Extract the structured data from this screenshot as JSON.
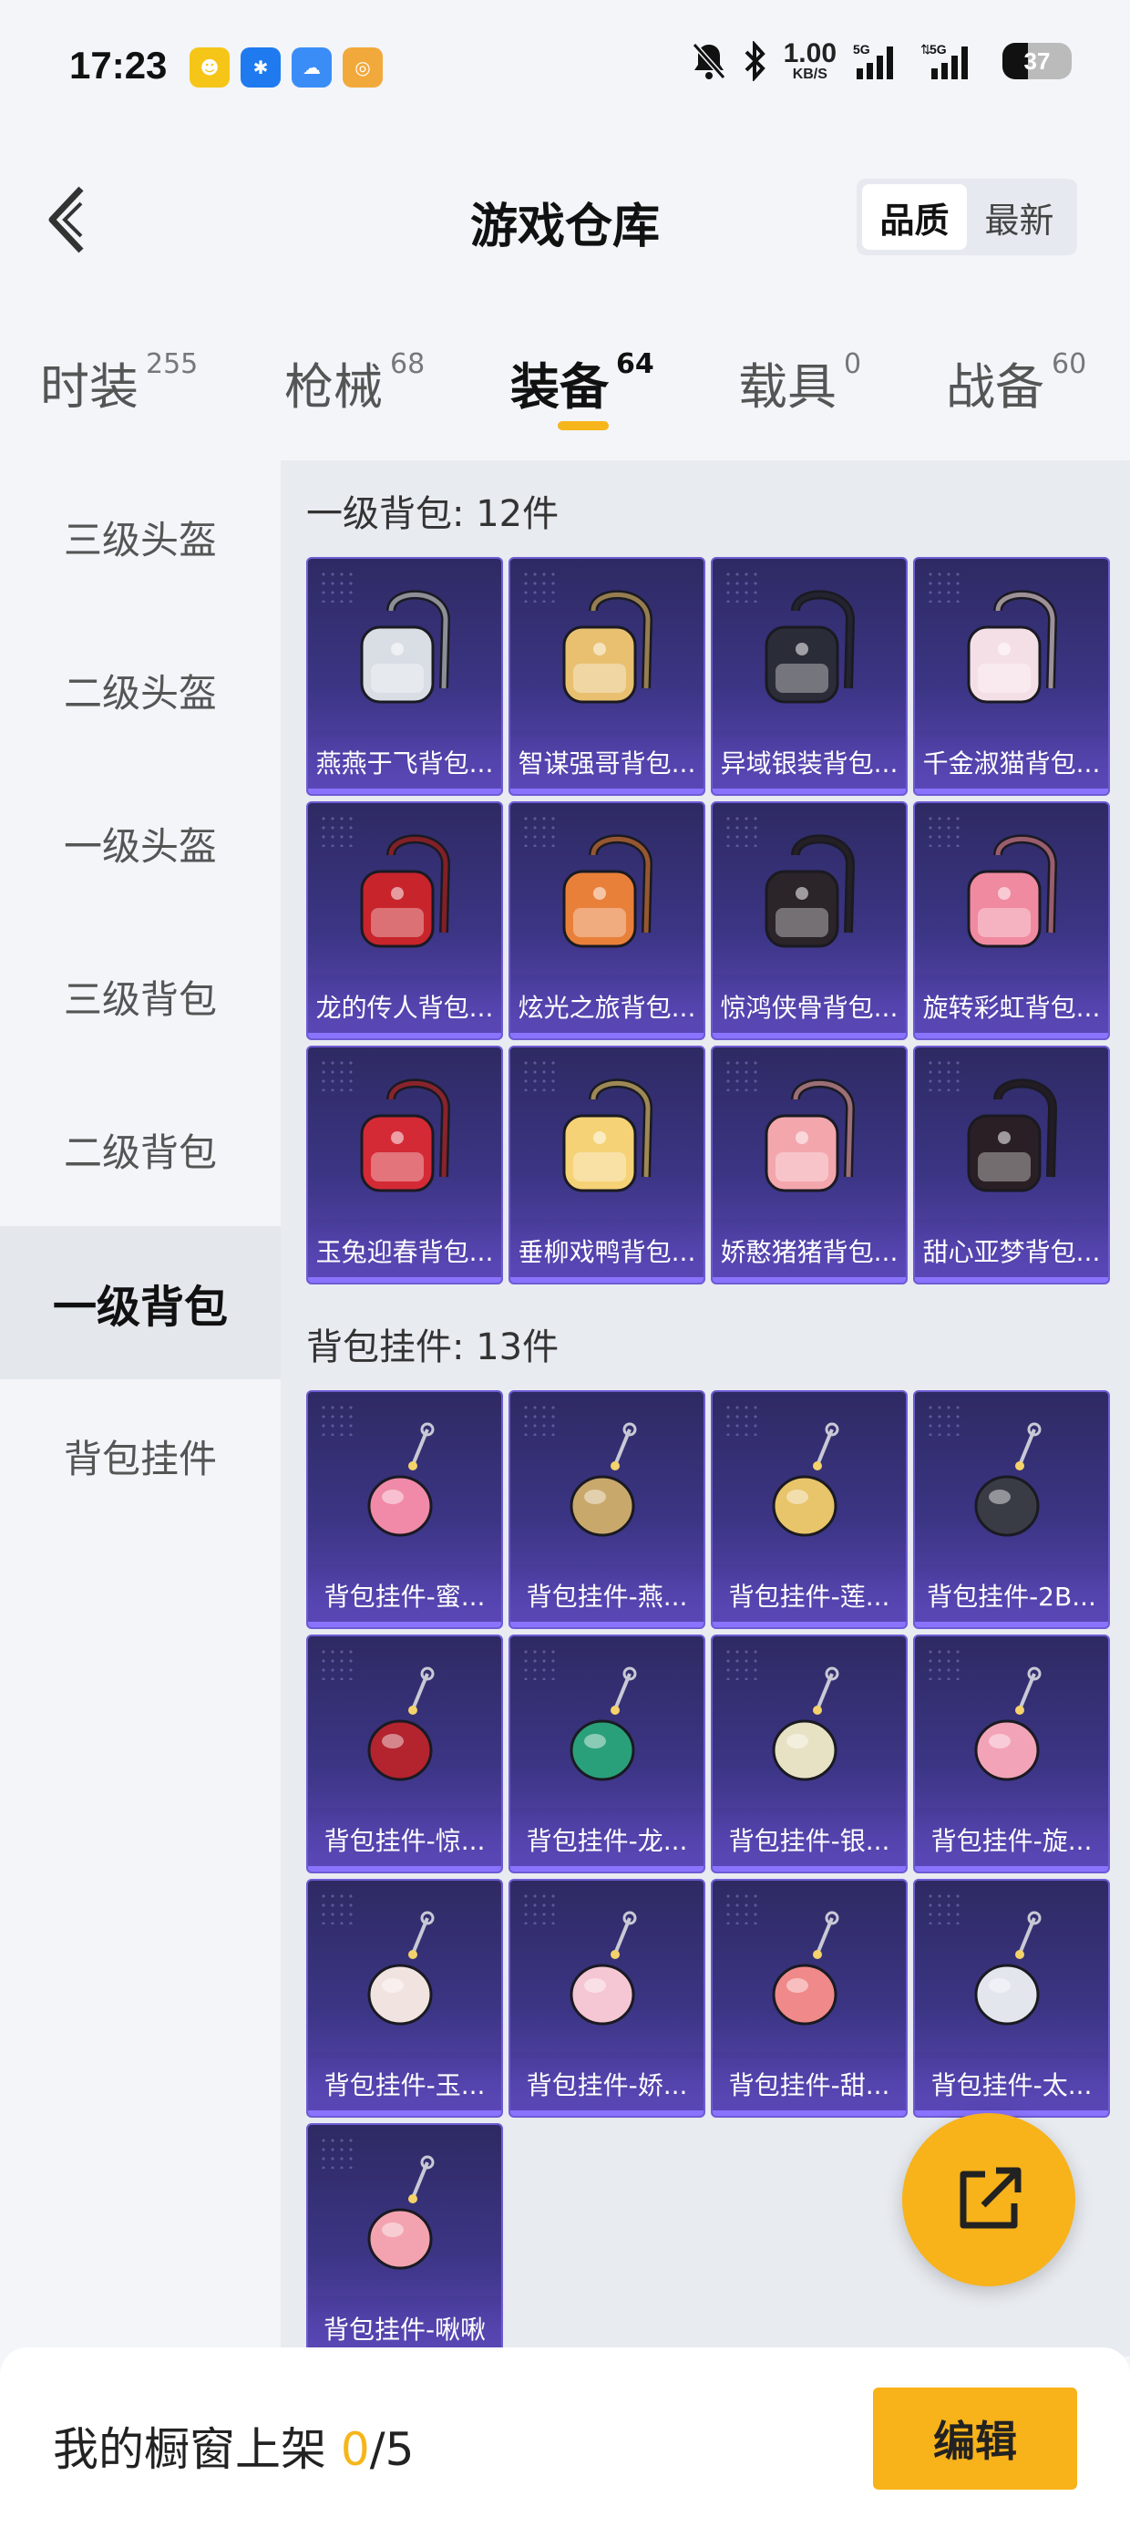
{
  "status_bar": {
    "time": "17:23",
    "net_speed_value": "1.00",
    "net_speed_unit": "KB/S",
    "battery": "37",
    "battery_level": 0.37
  },
  "header": {
    "title": "游戏仓库",
    "sort_options": [
      "品质",
      "最新"
    ],
    "sort_selected": "品质"
  },
  "tabs": [
    {
      "label": "时装",
      "count": "255"
    },
    {
      "label": "枪械",
      "count": "68"
    },
    {
      "label": "装备",
      "count": "64",
      "active": true
    },
    {
      "label": "载具",
      "count": "0"
    },
    {
      "label": "战备",
      "count": "60"
    }
  ],
  "sidebar": {
    "items": [
      "三级头盔",
      "二级头盔",
      "一级头盔",
      "三级背包",
      "二级背包",
      "一级背包",
      "背包挂件"
    ],
    "active": "一级背包"
  },
  "sections": [
    {
      "title": "一级背包: 12件",
      "items": [
        {
          "name": "燕燕于飞背包...",
          "icon": "backpack-icon",
          "color": "#d9dde4"
        },
        {
          "name": "智谋强哥背包...",
          "icon": "backpack-icon",
          "color": "#e8c070"
        },
        {
          "name": "异域银装背包...",
          "icon": "backpack-icon",
          "color": "#2a2c38"
        },
        {
          "name": "千金淑猫背包...",
          "icon": "backpack-icon",
          "color": "#f5dfe6"
        },
        {
          "name": "龙的传人背包...",
          "icon": "backpack-icon",
          "color": "#c8242c"
        },
        {
          "name": "炫光之旅背包...",
          "icon": "backpack-icon",
          "color": "#e9803a"
        },
        {
          "name": "惊鸿侠骨背包...",
          "icon": "backpack-icon",
          "color": "#2b2428"
        },
        {
          "name": "旋转彩虹背包...",
          "icon": "backpack-icon",
          "color": "#f08aa0"
        },
        {
          "name": "玉兔迎春背包...",
          "icon": "backpack-icon",
          "color": "#d42a35"
        },
        {
          "name": "垂柳戏鸭背包...",
          "icon": "backpack-icon",
          "color": "#f6d277"
        },
        {
          "name": "娇憨猪猪背包...",
          "icon": "backpack-icon",
          "color": "#f3a7ad"
        },
        {
          "name": "甜心亚梦背包...",
          "icon": "backpack-icon",
          "color": "#2a1f24"
        }
      ]
    },
    {
      "title": "背包挂件: 13件",
      "items": [
        {
          "name": "背包挂件-蜜...",
          "icon": "charm-icon",
          "color": "#f08aa8"
        },
        {
          "name": "背包挂件-燕...",
          "icon": "charm-icon",
          "color": "#c9a86b"
        },
        {
          "name": "背包挂件-莲...",
          "icon": "charm-icon",
          "color": "#e8c46a"
        },
        {
          "name": "背包挂件-2B...",
          "icon": "charm-icon",
          "color": "#3a3c45"
        },
        {
          "name": "背包挂件-惊...",
          "icon": "charm-icon",
          "color": "#b3242f"
        },
        {
          "name": "背包挂件-龙...",
          "icon": "charm-icon",
          "color": "#2aa07a"
        },
        {
          "name": "背包挂件-银...",
          "icon": "charm-icon",
          "color": "#e7e2c4"
        },
        {
          "name": "背包挂件-旋...",
          "icon": "charm-icon",
          "color": "#f3a3b8"
        },
        {
          "name": "背包挂件-玉...",
          "icon": "charm-icon",
          "color": "#f1e3e0"
        },
        {
          "name": "背包挂件-娇...",
          "icon": "charm-icon",
          "color": "#f5c6d3"
        },
        {
          "name": "背包挂件-甜...",
          "icon": "charm-icon",
          "color": "#f08a8a"
        },
        {
          "name": "背包挂件-太...",
          "icon": "charm-icon",
          "color": "#e4e6ee"
        },
        {
          "name": "背包挂件-啾啾",
          "icon": "charm-icon",
          "color": "#f3a3b0"
        }
      ]
    }
  ],
  "bottom_bar": {
    "showcase_label": "我的橱窗上架",
    "showcase_current": "0",
    "showcase_total": "/5",
    "edit_label": "编辑"
  },
  "colors": {
    "accent": "#f8b21a",
    "card_bg": "#3c3585"
  }
}
